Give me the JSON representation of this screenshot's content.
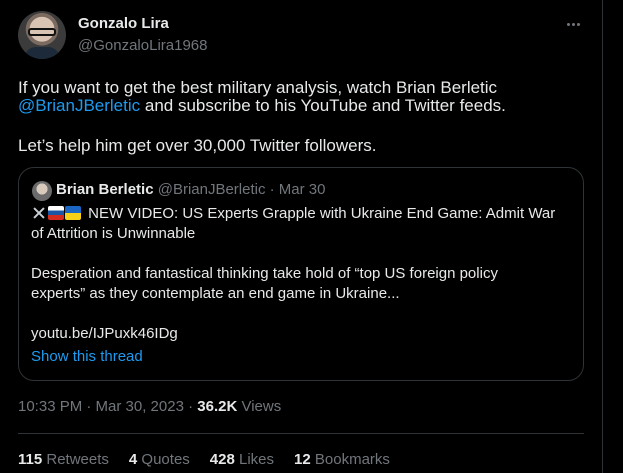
{
  "author": {
    "name": "Gonzalo Lira",
    "handle": "@GonzaloLira1968"
  },
  "tweet": {
    "line1": "If you want to get the best military analysis, watch Brian Berletic",
    "mention": "@BrianJBerletic",
    "line2_rest": " and subscribe to his YouTube and Twitter feeds.",
    "line3": "Let’s help him get over 30,000 Twitter followers."
  },
  "quoted": {
    "name": "Brian Berletic",
    "handle_date": "@BrianJBerletic · Mar 30",
    "emoji_icons": [
      "crossed-swords-icon",
      "russia-flag-icon",
      "ukraine-flag-icon"
    ],
    "headline_line1": " NEW VIDEO: US Experts Grapple with Ukraine End Game: Admit War",
    "headline_line2": "of Attrition is Unwinnable",
    "body_line1": "Desperation and fantastical thinking take hold of “top US foreign policy",
    "body_line2": "experts” as they contemplate an end game in Ukraine...",
    "link": "youtu.be/IJPuxk46IDg",
    "show_thread": "Show this thread"
  },
  "meta": {
    "time_date": "10:33 PM · Mar 30, 2023 · ",
    "views_count": "36.2K",
    "views_label": " Views"
  },
  "stats": {
    "retweets_count": "115",
    "retweets_label": "Retweets",
    "quotes_count": "4",
    "quotes_label": "Quotes",
    "likes_count": "428",
    "likes_label": "Likes",
    "bookmarks_count": "12",
    "bookmarks_label": "Bookmarks"
  },
  "colors": {
    "background": "#000000",
    "text": "#e7e9ea",
    "muted": "#71767b",
    "link": "#1d9bf0",
    "border": "#2f3336"
  }
}
